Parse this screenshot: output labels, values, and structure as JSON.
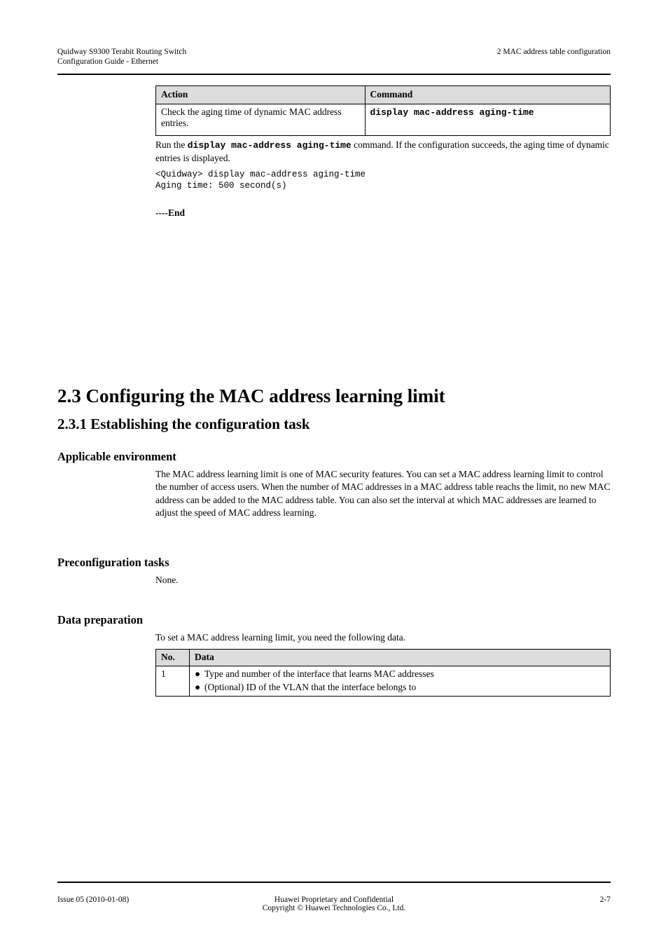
{
  "header": {
    "left_line1": "Quidway S9300 Terabit Routing Switch",
    "left_line2": "Configuration Guide - Ethernet",
    "right": "2 MAC address table configuration"
  },
  "footer": {
    "left": "Issue 05 (2010-01-08)",
    "center": "Huawei Proprietary and Confidential",
    "center2": "Copyright © Huawei Technologies Co., Ltd.",
    "right": "2-7"
  },
  "table1": {
    "headers": {
      "action": "Action",
      "command": "Command"
    },
    "row": {
      "action": "Check the aging time of dynamic MAC address entries.",
      "command_prefix": "display mac-address aging-time"
    }
  },
  "para1_lead": "Run the ",
  "para1_cmd": "display mac-address aging-time",
  "para1_rest": " command. If the configuration succeeds, the aging time of dynamic entries is displayed.",
  "code1_line1": "<Quidway> display mac-address aging-time",
  "code1_line2": "  Aging time: 500 second(s)",
  "end_marker": "----End",
  "h2": "2.3 Configuring the MAC address learning limit",
  "h3": "2.3.1 Establishing the configuration task",
  "h4_env": "Applicable environment",
  "env_para": "The MAC address learning limit is one of MAC security features. You can set a MAC address learning limit to control the number of access users. When the number of MAC addresses in a MAC address table reachs the limit, no new MAC address can be added to the MAC address table. You can also set the interval at which MAC addresses are learned to adjust the speed of MAC address learning.",
  "h4_pre": "Preconfiguration tasks",
  "pre_para": "None.",
  "h4_data": "Data preparation",
  "data_para": "To set a MAC address learning limit, you need the following data.",
  "table2": {
    "headers": {
      "no": "No.",
      "data": "Data"
    },
    "row": {
      "no": "1",
      "data_bullet1": "Type and number of the interface that learns MAC addresses",
      "data_bullet2": "(Optional) ID of the VLAN that the interface belongs to"
    }
  }
}
